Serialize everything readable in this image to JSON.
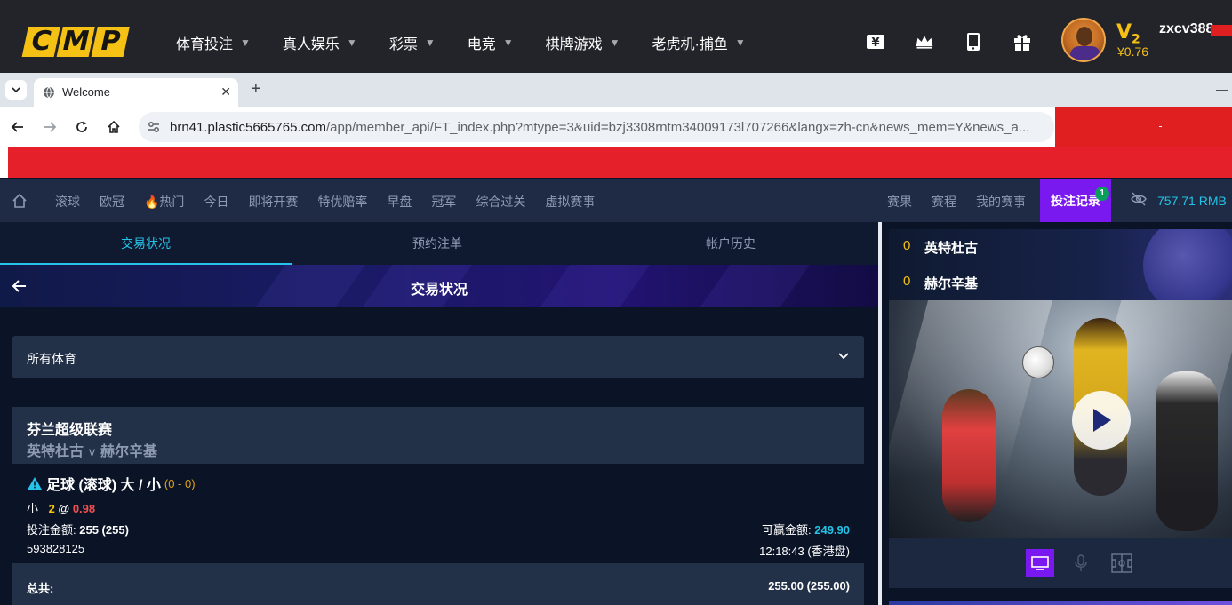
{
  "site": {
    "logo_letters": [
      "C",
      "M",
      "P"
    ],
    "nav": [
      {
        "label": "体育投注"
      },
      {
        "label": "真人娱乐"
      },
      {
        "label": "彩票"
      },
      {
        "label": "电竞"
      },
      {
        "label": "棋牌游戏"
      },
      {
        "label": "老虎机·捕鱼"
      }
    ],
    "icons": [
      "yen-wallet-icon",
      "crown-icon",
      "mobile-icon",
      "gift-icon"
    ],
    "vip_level": "V",
    "vip_num": "2",
    "balance": "¥0.76",
    "username": "zxcv388"
  },
  "browser": {
    "tab_title": "Welcome",
    "url_host": "brn41.plastic5665765.com",
    "url_path": "/app/member_api/FT_index.php?mtype=3&uid=bzj3308rntm34009173l707266&langx=zh-cn&news_mem=Y&news_a..."
  },
  "appnav": {
    "links": [
      "滚球",
      "欧冠",
      "🔥热门",
      "今日",
      "即将开赛",
      "特优赔率",
      "早盘",
      "冠军",
      "综合过关",
      "虚拟赛事"
    ],
    "right_links": [
      "赛果",
      "赛程",
      "我的赛事"
    ],
    "bet_record": "投注记录",
    "bet_record_badge": "1",
    "balance": "757.71  RMB"
  },
  "tabs": {
    "items": [
      "交易状况",
      "预约注单",
      "帐户历史"
    ],
    "active": "交易状况"
  },
  "banner": {
    "title": "交易状况"
  },
  "filter": {
    "selected": "所有体育"
  },
  "bet": {
    "league": "芬兰超级联赛",
    "home": "英特杜古",
    "vs": "v",
    "away": "赫尔辛基",
    "market": "足球 (滚球) 大 / 小",
    "score": "(0 - 0)",
    "side": "小",
    "line": "2",
    "at": "@",
    "odds": "0.98",
    "stake_label": "投注金额:",
    "stake_value": "255 (255)",
    "win_label": "可赢金额:",
    "win_value": "249.90",
    "bet_id": "593828125",
    "time": "12:18:43 (香港盘)",
    "total_label": "总共:",
    "total_value": "255.00 (255.00)"
  },
  "match": {
    "home_score": "0",
    "home": "英特杜古",
    "away_score": "0",
    "away": "赫尔辛基"
  },
  "colors": {
    "accent_purple": "#7a18f0",
    "cyan": "#26c4ea",
    "gold": "#f5c114",
    "odds_red": "#f05050"
  }
}
